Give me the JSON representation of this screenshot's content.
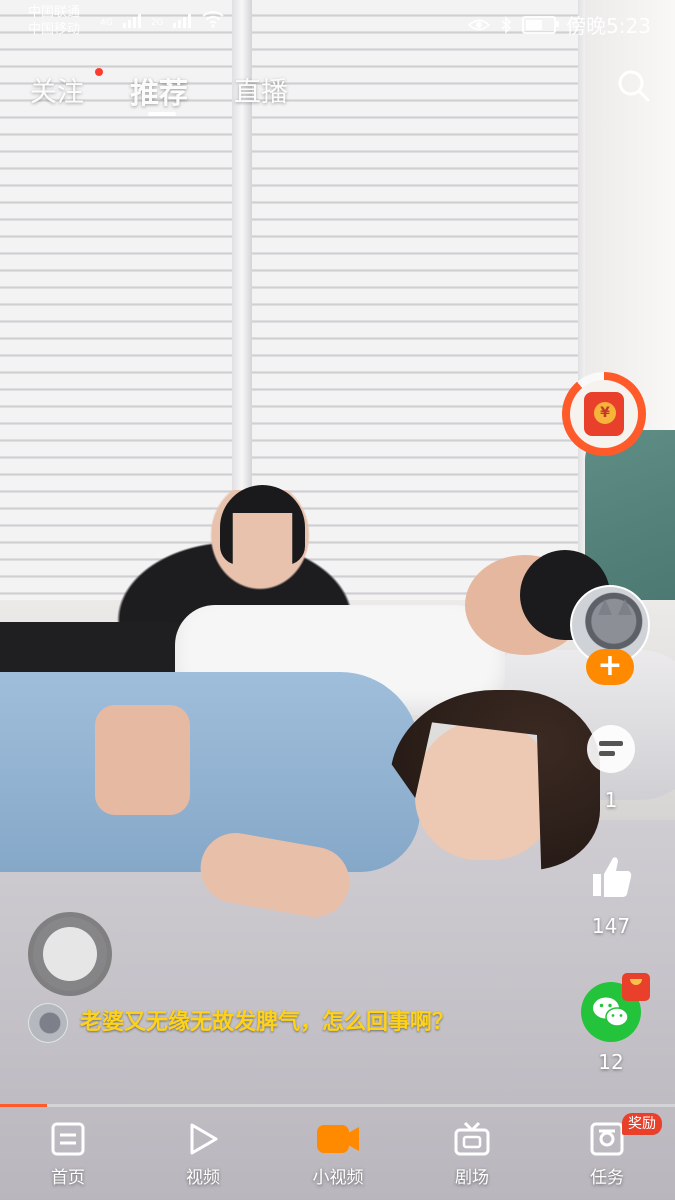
{
  "status_bar": {
    "carrier_line1": "中国联通",
    "carrier_line2": "中国移动",
    "net1": "4G",
    "net2": "2G",
    "time": "傍晚5:23"
  },
  "top_tabs": [
    {
      "label": "关注",
      "has_dot": true
    },
    {
      "label": "推荐",
      "active": true
    },
    {
      "label": "直播"
    }
  ],
  "actions": {
    "comments_count": "1",
    "likes_count": "147",
    "shares_count": "12",
    "redpack_symbol": "¥",
    "follow_symbol": "+"
  },
  "caption": {
    "text": "老婆又无缘无故发脾气，怎么回事啊？"
  },
  "progress": {
    "fraction": 0.07
  },
  "bottom_nav": [
    {
      "label": "首页",
      "icon": "home-icon"
    },
    {
      "label": "视频",
      "icon": "play-icon"
    },
    {
      "label": "小视频",
      "icon": "short-video-icon",
      "active": true
    },
    {
      "label": "剧场",
      "icon": "tv-icon"
    },
    {
      "label": "任务",
      "icon": "task-icon",
      "badge": "奖励"
    }
  ],
  "colors": {
    "accent": "#ff8a00",
    "caption": "#ffd21a",
    "wechat": "#23c33c",
    "red": "#e8402b"
  }
}
